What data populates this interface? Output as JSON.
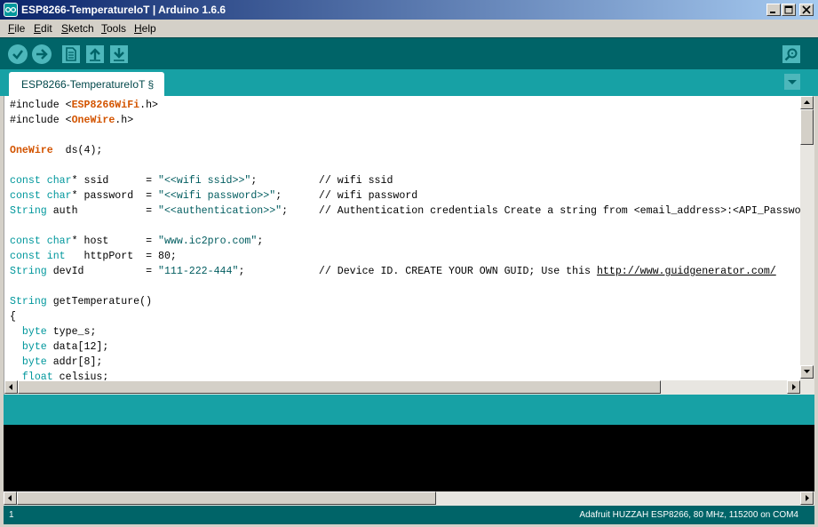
{
  "window": {
    "title": "ESP8266-TemperatureIoT | Arduino 1.6.6"
  },
  "menu": {
    "items": [
      {
        "label": "File",
        "hotkey": "F"
      },
      {
        "label": "Edit",
        "hotkey": "E"
      },
      {
        "label": "Sketch",
        "hotkey": "S"
      },
      {
        "label": "Tools",
        "hotkey": "T"
      },
      {
        "label": "Help",
        "hotkey": "H"
      }
    ]
  },
  "toolbar": {
    "buttons": [
      {
        "name": "verify-button",
        "icon": "check-icon"
      },
      {
        "name": "upload-button",
        "icon": "arrow-right-icon"
      },
      {
        "name": "new-button",
        "icon": "new-file-icon"
      },
      {
        "name": "open-button",
        "icon": "arrow-up-icon"
      },
      {
        "name": "save-button",
        "icon": "arrow-down-icon"
      },
      {
        "name": "serial-monitor-button",
        "icon": "magnifier-icon"
      }
    ]
  },
  "tabs": [
    {
      "label": "ESP8266-TemperatureIoT §"
    }
  ],
  "code": {
    "lines": [
      "#include <ESP8266WiFi.h>",
      "#include <OneWire.h>",
      "",
      "OneWire  ds(4);",
      "",
      "const char* ssid      = \"<<wifi ssid>>\";          // wifi ssid",
      "const char* password  = \"<<wifi password>>\";      // wifi password",
      "String auth           = \"<<authentication>>\";     // Authentication credentials Create a string from <email_address>:<API_Passwo",
      "",
      "const char* host      = \"www.ic2pro.com\";",
      "const int   httpPort  = 80;",
      "String devId          = \"111-222-444\";            // Device ID. CREATE YOUR OWN GUID; Use this http://www.guidgenerator.com/",
      "",
      "String getTemperature()",
      "{",
      "  byte type_s;",
      "  byte data[12];",
      "  byte addr[8];",
      "  float celsius;"
    ]
  },
  "status": {
    "line_number": "1",
    "board": "Adafruit HUZZAH ESP8266, 80 MHz, 115200 on COM4"
  },
  "colors": {
    "toolbar": "#006468",
    "tabstrip": "#17a1a5",
    "button": "#4db7bb",
    "keyword": "#00979c",
    "library": "#d35400",
    "string": "#005c5f"
  }
}
